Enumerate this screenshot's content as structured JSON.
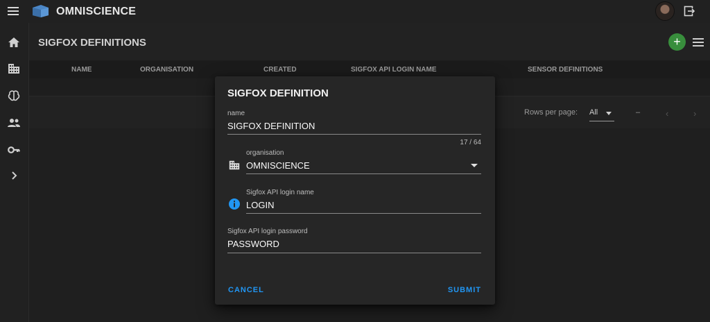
{
  "app": {
    "brand": "OMNISCIENCE"
  },
  "icons": {
    "menu": "hamburger-menu-icon",
    "logo": "cube-logo-icon",
    "logout": "logout-icon",
    "nav": [
      "home-icon",
      "building-icon",
      "brain-icon",
      "users-icon",
      "key-icon",
      "chevron-right-icon"
    ]
  },
  "page": {
    "title": "SIGFOX DEFINITIONS",
    "add_label": "+",
    "columns": [
      "NAME",
      "ORGANISATION",
      "CREATED",
      "SIGFOX API LOGIN NAME",
      "SENSOR DEFINITIONS"
    ],
    "pagination": {
      "rows_per_page_label": "Rows per page:",
      "rows_per_page_value": "All",
      "range": "–",
      "prev": "‹",
      "next": "›"
    }
  },
  "dialog": {
    "title": "SIGFOX DEFINITION",
    "name_label": "name",
    "name_value": "SIGFOX DEFINITION",
    "name_counter": "17 / 64",
    "organisation_label": "organisation",
    "organisation_value": "OMNISCIENCE",
    "login_label": "Sigfox API login name",
    "login_value": "LOGIN",
    "password_label": "Sigfox API login password",
    "password_value": "PASSWORD",
    "cancel_label": "CANCEL",
    "submit_label": "SUBMIT"
  },
  "colors": {
    "accent": "#2196f3",
    "add_button": "#388e3c",
    "info_icon": "#2196f3"
  }
}
